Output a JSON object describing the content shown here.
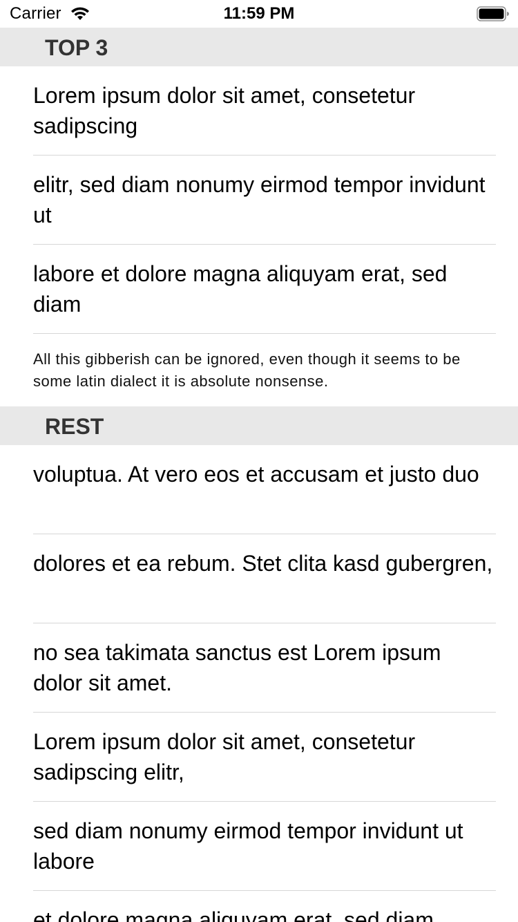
{
  "status_bar": {
    "carrier": "Carrier",
    "time": "11:59 PM",
    "icons": [
      "wifi-icon",
      "battery-icon"
    ]
  },
  "sections": [
    {
      "header": "TOP 3",
      "rows": [
        "Lorem ipsum dolor sit amet, consetetur sadipscing",
        "elitr, sed diam nonumy eirmod tempor invidunt ut",
        "labore et dolore magna aliquyam erat, sed diam"
      ],
      "footer": "All this gibberish can be ignored, even though it seems to be some latin dialect it is absolute nonsense."
    },
    {
      "header": "REST",
      "rows": [
        "voluptua. At vero eos et accusam et justo duo",
        "dolores et ea rebum. Stet clita kasd gubergren,",
        "no sea takimata sanctus est Lorem ipsum dolor sit amet.",
        "Lorem ipsum dolor sit amet, consetetur sadipscing elitr,",
        "sed diam nonumy eirmod tempor invidunt ut labore",
        "et dolore magna aliquyam erat, sed diam"
      ]
    }
  ],
  "colors": {
    "header_bg": "#e8e8e8",
    "header_text": "#333333",
    "separator": "#d6d6d6"
  }
}
